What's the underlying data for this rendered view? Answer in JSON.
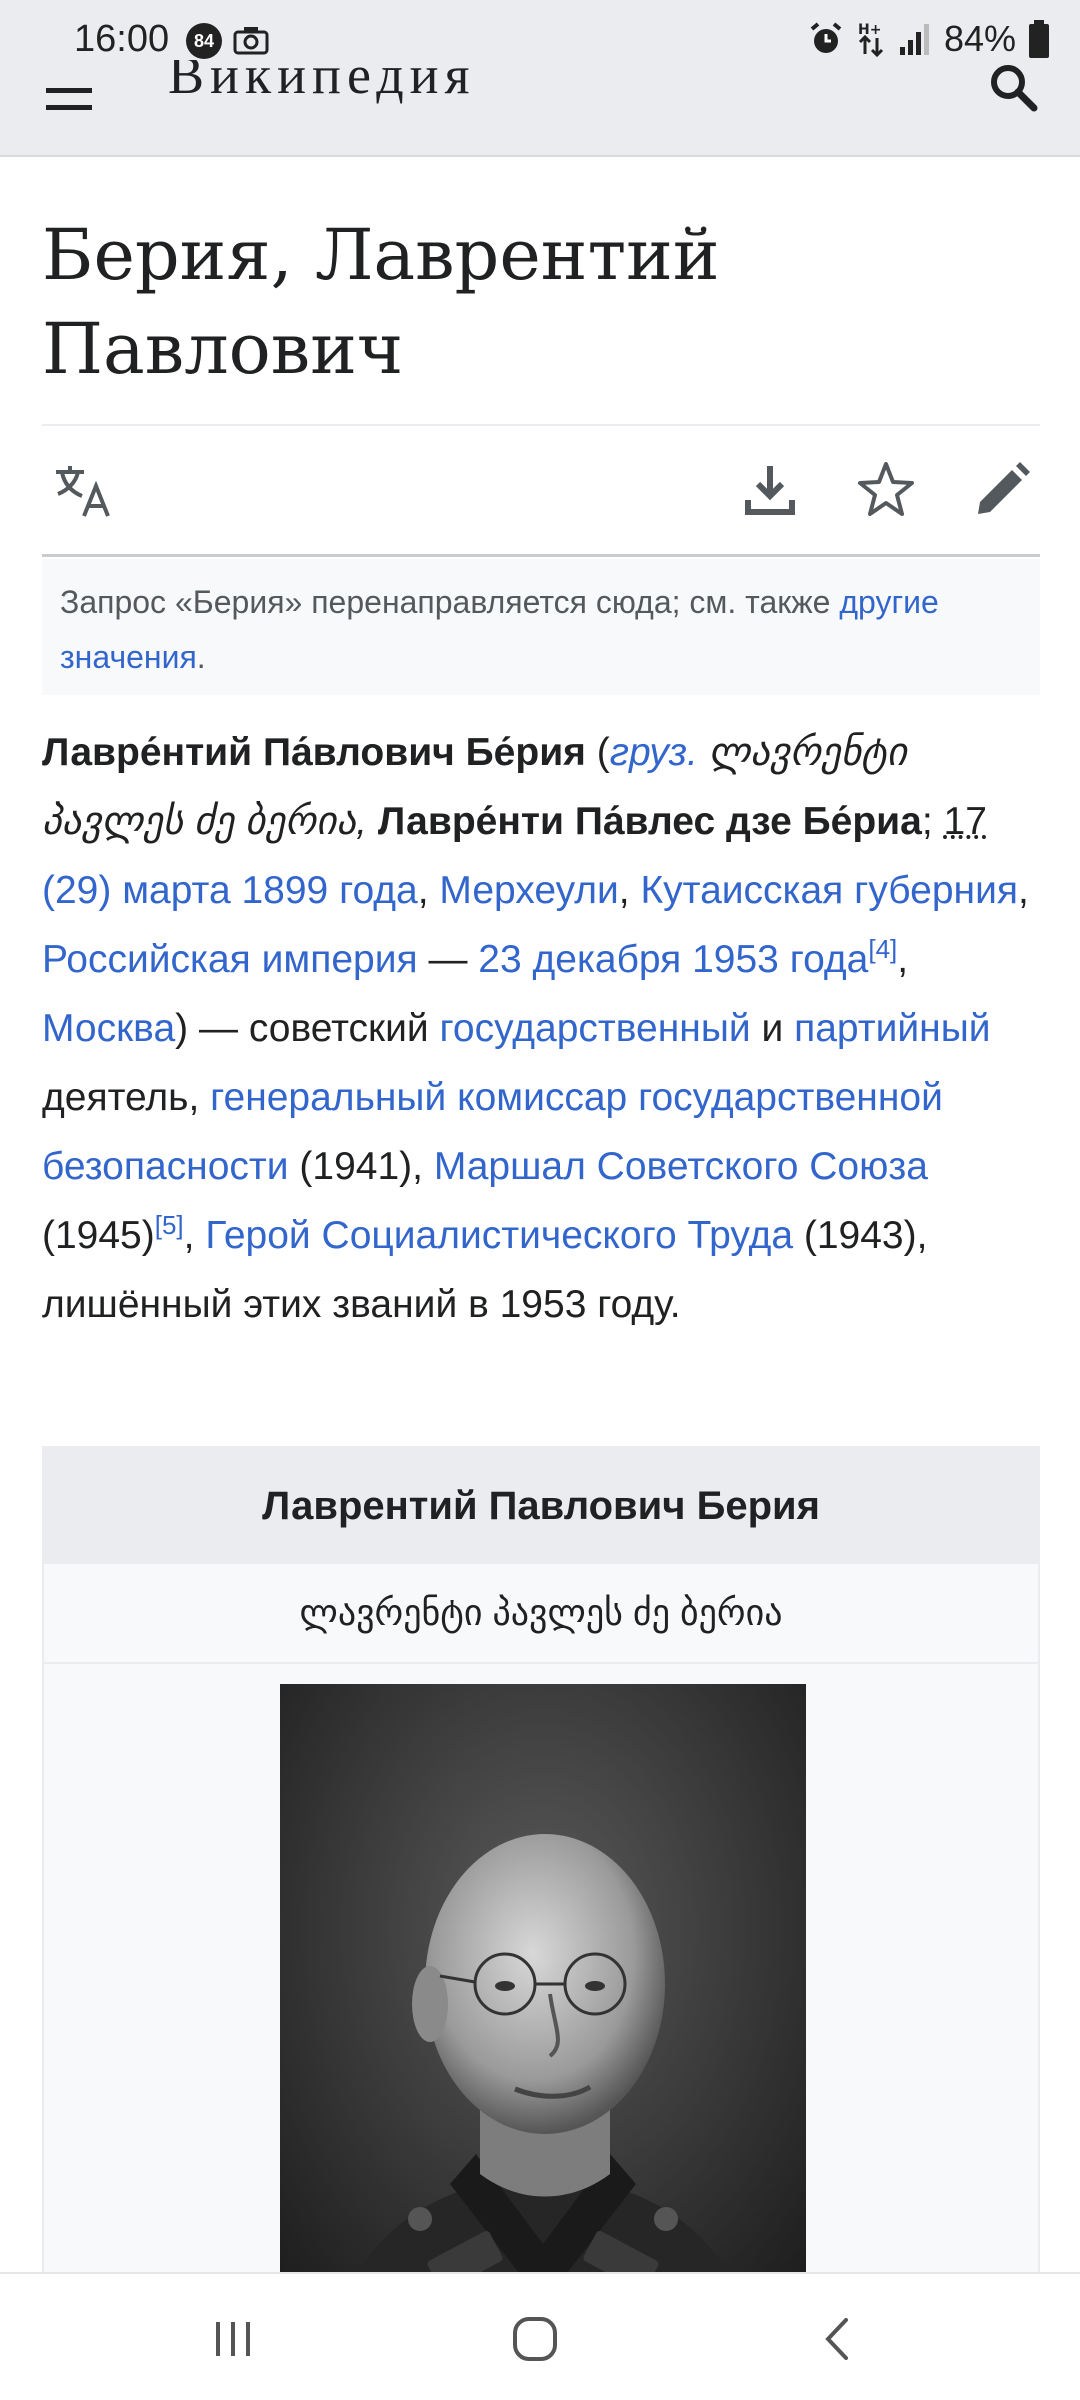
{
  "status_bar": {
    "time": "16:00",
    "notification_badge": "84",
    "battery_percent": "84%"
  },
  "header": {
    "logo_text": "Википедия"
  },
  "article": {
    "title": "Берия, Лаврентий Павлович"
  },
  "hatnote": {
    "text": "Запрос «Берия» перенаправляется сюда; см. также ",
    "link": "другие значения",
    "end": "."
  },
  "lead": {
    "name_bold": "Лавре́нтий Па́влович Бе́рия",
    "p_open": " (",
    "lang_link": "груз.",
    "georgian_name": " ლავრენტი პავლეს ძე ბერია,",
    "alt_bold": " Лавре́нти Па́влес дзе Бе́риа",
    "semicolon": "; ",
    "day_old": "17",
    "date_link": " (29) марта 1899 года",
    "comma1": ", ",
    "place1": "Мерхеули",
    "comma2": ", ",
    "place2": "Кутаисская губерния",
    "comma3": ", ",
    "place3": "Российская империя",
    "dash": " — ",
    "death_date": "23 декабря 1953 года",
    "ref4": "[4]",
    "comma4": ", ",
    "death_place": "Москва",
    "soviet_text": ") — советский ",
    "state_link": "государственный",
    "and_text": " и ",
    "party_link": "партийный",
    "figure_text": " деятель, ",
    "commissar_link": "генеральный комиссар государственной безопасности",
    "y1941": " (1941), ",
    "marshal_link": "Маршал Советского Союза",
    "y1945": " (1945)",
    "ref5": "[5]",
    "comma5": ", ",
    "hero_link": "Герой Социалистического Труда",
    "ending": " (1943), лишённый этих званий в 1953 году."
  },
  "infobox": {
    "title": "Лаврентий Павлович Берия",
    "georgian": "ლავრენტი პავლეს ძე ბერია"
  },
  "icons": {
    "menu": "hamburger-icon",
    "search": "search-icon",
    "language": "translate-icon",
    "download": "download-icon",
    "watch": "star-icon",
    "edit": "pencil-icon"
  },
  "colors": {
    "link": "#3366cc",
    "header_bg": "#eaecf0",
    "text": "#202122"
  }
}
